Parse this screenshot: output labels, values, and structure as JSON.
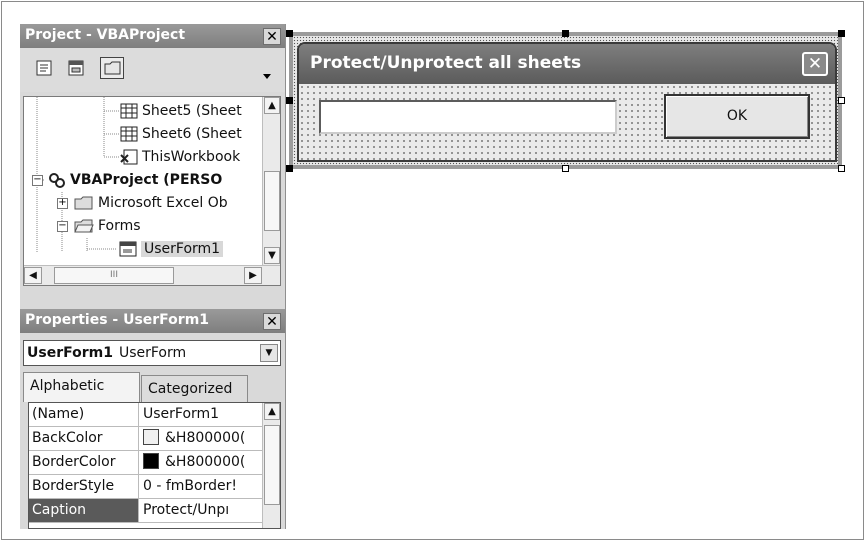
{
  "project_panel": {
    "title": "Project - VBAProject",
    "close_label": "✕",
    "toolbar": [
      "view-code-icon",
      "view-object-icon",
      "toggle-folders-icon"
    ],
    "tree": [
      {
        "label": "Sheet5 (Sheet",
        "icon": "worksheet-icon"
      },
      {
        "label": "Sheet6 (Sheet",
        "icon": "worksheet-icon"
      },
      {
        "label": "ThisWorkbook",
        "icon": "workbook-icon"
      },
      {
        "label": "VBAProject (PERSO",
        "icon": "vba-project-icon",
        "expander": "−"
      },
      {
        "label": "Microsoft Excel Ob",
        "icon": "folder-icon",
        "expander": "+"
      },
      {
        "label": "Forms",
        "icon": "open-folder-icon",
        "expander": "−"
      },
      {
        "label": "UserForm1",
        "icon": "userform-icon",
        "selected": true
      }
    ],
    "hscroll_thumb_label": "III"
  },
  "properties_panel": {
    "title": "Properties - UserForm1",
    "close_label": "✕",
    "object_name": "UserForm1",
    "object_type": "UserForm",
    "tabs": [
      "Alphabetic",
      "Categorized"
    ],
    "rows": [
      {
        "name": "(Name)",
        "value": "UserForm1"
      },
      {
        "name": "BackColor",
        "value": "&H800000(",
        "swatch": "#f0f0f0"
      },
      {
        "name": "BorderColor",
        "value": "&H800000(",
        "swatch": "#000000"
      },
      {
        "name": "BorderStyle",
        "value": "0 - fmBorder!"
      },
      {
        "name": "Caption",
        "value": "Protect/Unpı",
        "selected": true
      }
    ]
  },
  "userform": {
    "caption": "Protect/Unprotect all sheets",
    "close_label": "✕",
    "textbox_value": "",
    "ok_label": "OK"
  },
  "colors": {
    "title_gray": "#7e7e7e",
    "selection_gray": "#5a5a5a",
    "panel_bg": "#d9d9d9"
  }
}
